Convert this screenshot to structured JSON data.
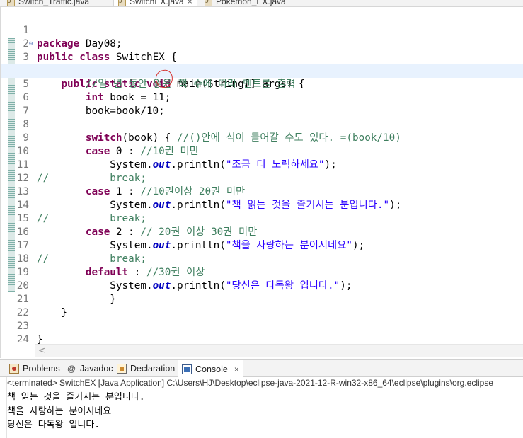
{
  "editor_tabs": [
    {
      "label": "Switch_Traffic.java",
      "active": false
    },
    {
      "label": "SwitchEX.java",
      "active": true,
      "close": "×"
    },
    {
      "label": "Pokemon_EX.java",
      "active": false
    }
  ],
  "code_lines": [
    {
      "n": "1"
    },
    {
      "n": "2"
    },
    {
      "n": "3"
    },
    {
      "n": "4"
    },
    {
      "n": "5"
    },
    {
      "n": "6"
    },
    {
      "n": "7"
    },
    {
      "n": "8"
    },
    {
      "n": "9"
    },
    {
      "n": "10"
    },
    {
      "n": "11"
    },
    {
      "n": "12"
    },
    {
      "n": "13"
    },
    {
      "n": "14"
    },
    {
      "n": "15"
    },
    {
      "n": "16"
    },
    {
      "n": "17"
    },
    {
      "n": "18"
    },
    {
      "n": "19"
    },
    {
      "n": "20"
    },
    {
      "n": "21"
    },
    {
      "n": "22"
    },
    {
      "n": "23"
    },
    {
      "n": "24"
    }
  ],
  "code": {
    "l1": {
      "kw": "package",
      "rest": " Day08;"
    },
    "l2": {
      "kw1": "public",
      "kw2": "class",
      "rest": " SwitchEX {"
    },
    "l3": {
      "indent": "    ",
      "kw1": "public",
      "kw2": "static",
      "kw3": "void",
      "rest": " main(String[] args) {"
    },
    "l4": {
      "indent": "        ",
      "comment": "//일 년 동안 읽은 책 수에 따라 멘트를 출력"
    },
    "l5": {
      "indent": "        ",
      "kw": "int",
      "rest": " book = 11;"
    },
    "l6": {
      "indent": "        ",
      "rest": "book=book/10;"
    },
    "l7": {
      "text": ""
    },
    "l8": {
      "indent": "        ",
      "kw": "switch",
      "rest": "(book) { ",
      "comment": "//()안에 식이 들어갈 수도 있다. =(book/10)"
    },
    "l9": {
      "indent": "        ",
      "kw": "case",
      "rest": " 0 : ",
      "comment": "//10권 미만"
    },
    "l10": {
      "indent": "            ",
      "pre": "System.",
      "field": "out",
      "mid": ".println(",
      "str": "\"조금 더 노력하세요\"",
      "post": ");"
    },
    "l11": {
      "comment": "//",
      "gap": "          ",
      "kw": "break",
      "rest": ";"
    },
    "l12": {
      "indent": "        ",
      "kw": "case",
      "rest": " 1 : ",
      "comment": "//10권이상 20권 미만"
    },
    "l13": {
      "indent": "            ",
      "pre": "System.",
      "field": "out",
      "mid": ".println(",
      "str": "\"책 읽는 것을 즐기시는 분입니다.\"",
      "post": ");"
    },
    "l14": {
      "comment": "//",
      "gap": "          ",
      "kw": "break",
      "rest": ";"
    },
    "l15": {
      "indent": "        ",
      "kw": "case",
      "rest": " 2 : ",
      "comment": "// 20권 이상 30권 미만"
    },
    "l16": {
      "indent": "            ",
      "pre": "System.",
      "field": "out",
      "mid": ".println(",
      "str": "\"책을 사랑하는 분이시네요\"",
      "post": ");"
    },
    "l17": {
      "comment": "//",
      "gap": "          ",
      "kw": "break",
      "rest": ";"
    },
    "l18": {
      "indent": "        ",
      "kw": "default",
      "rest": " : ",
      "comment": "//30권 이상"
    },
    "l19": {
      "indent": "            ",
      "pre": "System.",
      "field": "out",
      "mid": ".println(",
      "str": "\"당신은 다독왕 입니다.\"",
      "post": ");"
    },
    "l20": {
      "text": "            }"
    },
    "l21": {
      "text": "    }"
    },
    "l22": {
      "text": ""
    },
    "l23": {
      "text": "}"
    },
    "l24": {
      "text": ""
    }
  },
  "fold_markers": {
    "l3": "⊖"
  },
  "editor_scroll_arrow": "<",
  "panel_tabs": {
    "problems": "Problems",
    "javadoc": "Javadoc",
    "javadoc_icon": "@",
    "declaration": "Declaration",
    "console": "Console",
    "console_close": "×"
  },
  "console": {
    "header": "<terminated> SwitchEX [Java Application] C:\\Users\\HJ\\Desktop\\eclipse-java-2021-12-R-win32-x86_64\\eclipse\\plugins\\org.eclipse",
    "lines": [
      "책 읽는 것을 즐기시는 분입니다.",
      "책을 사랑하는 분이시네요",
      "당신은 다독왕 입니다."
    ]
  },
  "colors": {
    "keyword": "#7f0055",
    "comment": "#3f7f5f",
    "string": "#2a00ff",
    "field": "#0000c0",
    "current_line": "#e8f2fe",
    "annotation_circle": "#d6322f"
  },
  "icons": {
    "java_file": "java-file-icon",
    "problems": "problems-icon",
    "javadoc": "javadoc-icon",
    "declaration": "declaration-icon",
    "console": "console-icon"
  }
}
